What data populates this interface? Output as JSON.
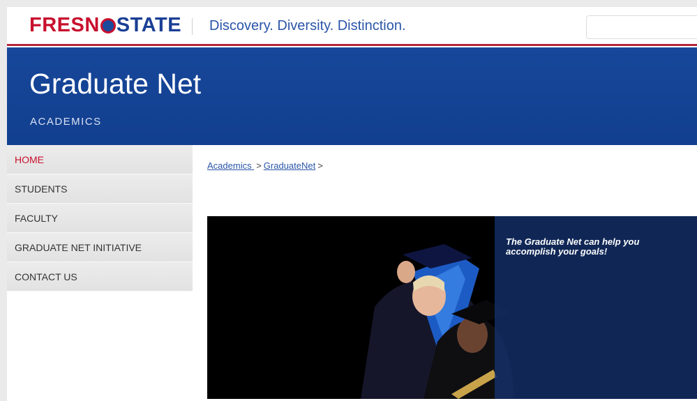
{
  "header": {
    "logo": {
      "part1": "FRESN",
      "part2": "STATE"
    },
    "tagline": "Discovery. Diversity. Distinction.",
    "search": {
      "value": "",
      "placeholder": ""
    }
  },
  "banner": {
    "title": "Graduate Net",
    "subtitle": "ACADEMICS"
  },
  "sidebar": {
    "items": [
      {
        "label": "HOME",
        "active": true
      },
      {
        "label": "STUDENTS"
      },
      {
        "label": "FACULTY"
      },
      {
        "label": "GRADUATE NET INITIATIVE"
      },
      {
        "label": "CONTACT US"
      }
    ]
  },
  "breadcrumb": {
    "items": [
      {
        "label": "Academics "
      },
      {
        "label": "GraduateNet"
      }
    ],
    "separator": ">"
  },
  "hero": {
    "caption": "The Graduate Net can help you accomplish your goals!"
  },
  "colors": {
    "brand_red": "#c8102e",
    "brand_blue": "#17479a",
    "link_blue": "#2a55a8"
  }
}
